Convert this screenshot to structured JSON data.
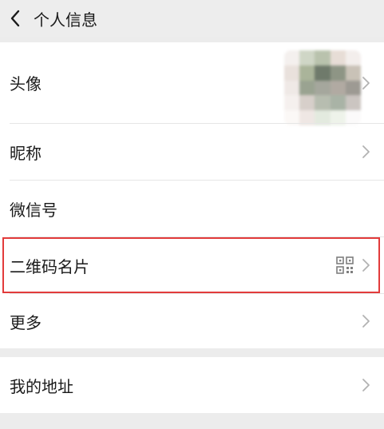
{
  "header": {
    "title": "个人信息",
    "back_icon": "chevron-left-icon"
  },
  "profile": {
    "avatar_label": "头像",
    "nickname_label": "昵称",
    "wechat_id_label": "微信号",
    "qr_card_label": "二维码名片",
    "more_label": "更多"
  },
  "address": {
    "label": "我的地址"
  },
  "colors": {
    "highlight": "#e23b3b",
    "background": "#ececec",
    "row_bg": "#ffffff"
  },
  "icons": {
    "chevron": "chevron-right-icon",
    "qr": "qr-code-icon"
  }
}
